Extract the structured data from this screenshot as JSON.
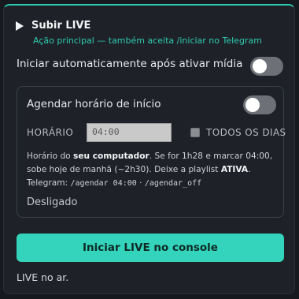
{
  "panel": {
    "title": "Subir LIVE",
    "subtitle": "Ação principal — também aceita /iniciar no Telegram",
    "accent_color": "#2ec9b0"
  },
  "auto_start": {
    "label": "Iniciar automaticamente após ativar mídia",
    "enabled": false
  },
  "schedule": {
    "label": "Agendar horário de início",
    "enabled": false,
    "time_label": "HORÁRIO",
    "time_value": "04:00",
    "every_day_label": "TODOS OS DIAS",
    "every_day_checked": false,
    "help": {
      "part1": "Horário do ",
      "bold1": "seu computador",
      "part2": ". Se for 1h28 e marcar 04:00,",
      "line2a": "sobe hoje de manhã (~2h30). Deixe a playlist ",
      "bold2": "ATIVA",
      "line2b": ".",
      "line3a": "Telegram: ",
      "cmd1": "/agendar 04:00",
      "sep": " · ",
      "cmd2": "/agendar_off"
    },
    "status": "Desligado"
  },
  "start_button": {
    "label": "Iniciar LIVE no console",
    "color": "#34d3bb"
  },
  "live_status": "LIVE no ar."
}
